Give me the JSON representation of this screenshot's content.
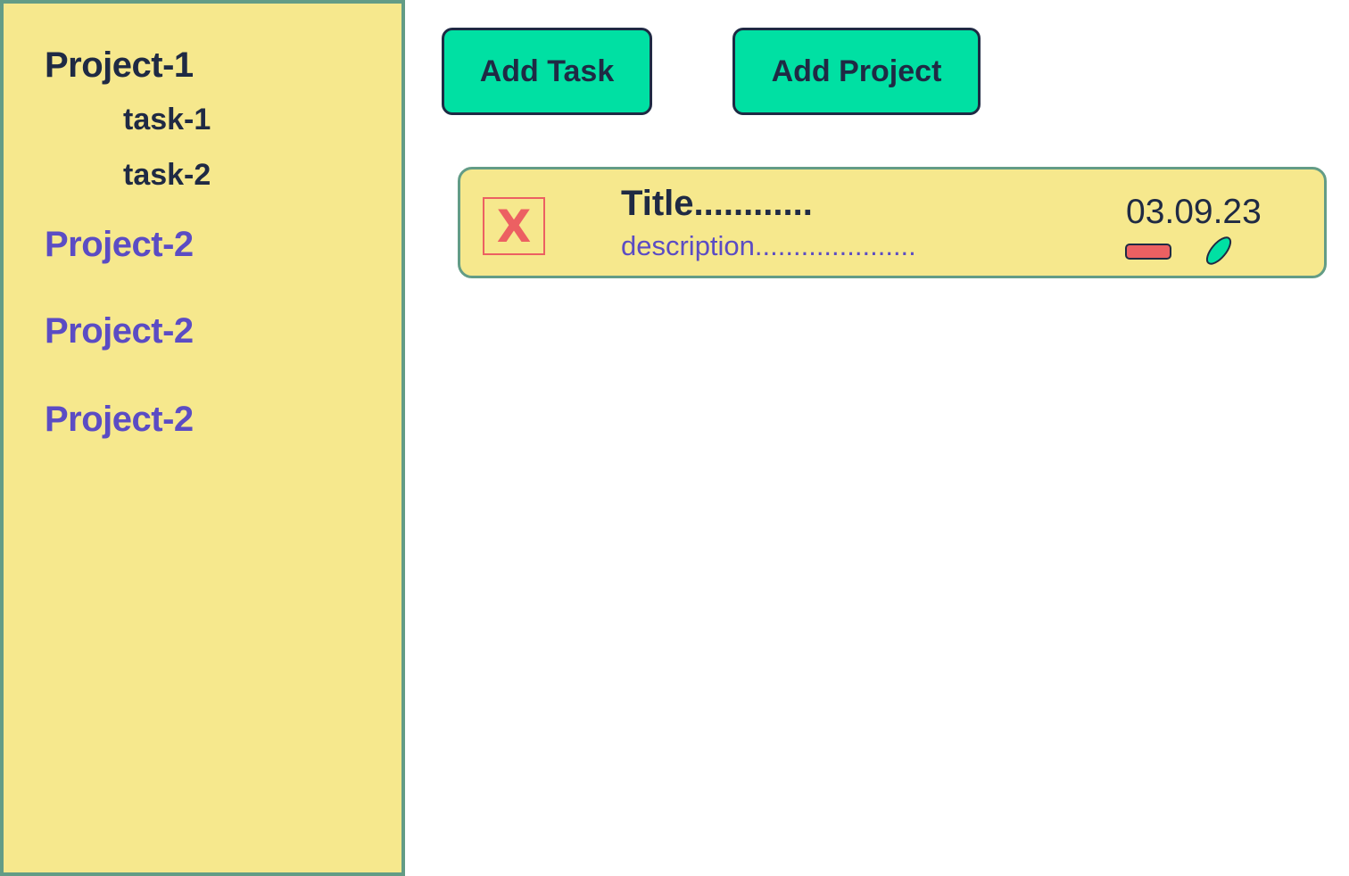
{
  "sidebar": {
    "projects": [
      {
        "label": "Project-1",
        "tasks": [
          "task-1",
          "task-2"
        ]
      },
      {
        "label": "Project-2"
      },
      {
        "label": "Project-2"
      },
      {
        "label": "Project-2"
      }
    ]
  },
  "toolbar": {
    "add_task_label": "Add Task",
    "add_project_label": "Add Project"
  },
  "task_card": {
    "title": "Title............",
    "description": "description.....................",
    "date": "03.09.23",
    "delete_symbol": "X",
    "priority_color": "#ec6062",
    "edit_icon": "leaf-icon"
  },
  "colors": {
    "accent": "#00e0a3",
    "panel": "#f6e88d",
    "border": "#639c86",
    "text_dark": "#1f2a44",
    "text_purple": "#5b4cc4",
    "danger": "#ec6062"
  }
}
